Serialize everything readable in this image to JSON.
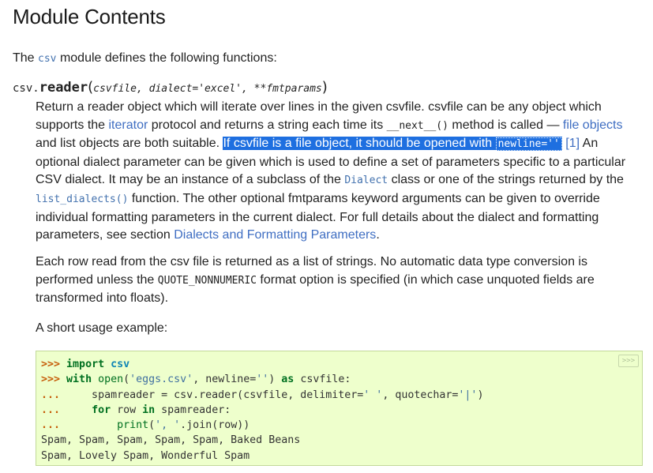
{
  "title": "Module Contents",
  "intro": {
    "pre": "The ",
    "code": "csv",
    "post": " module defines the following functions:"
  },
  "signature": {
    "prefix": "csv.",
    "name": "reader",
    "open": "(",
    "args": "csvfile, dialect='excel', **fmtparams",
    "close": ")"
  },
  "para1": {
    "l1": "Return a reader object which will iterate over lines in the given csvfile. csvfile can be any object which",
    "l2_a": "supports the ",
    "l2_link": "iterator",
    "l2_b": " protocol and returns a string each time its ",
    "l2_code": "__next__()",
    "l2_c": " method is called — ",
    "l2_link2": "file objects",
    "l3_a": "and list objects are both suitable. ",
    "l3_hl_a": "If csvfile is a file object, it should be opened with ",
    "l3_hl_code": "newline=''",
    "l3_footnote": "[1]",
    "l3_b": " An",
    "l4": "optional dialect parameter can be given which is used to define a set of parameters specific to a particular",
    "l5_a": "CSV dialect. It may be an instance of a subclass of the ",
    "l5_code": "Dialect",
    "l5_b": " class or one of the strings returned by the",
    "l6_code": "list_dialects()",
    "l6_b": " function. The other optional fmtparams keyword arguments can be given to override",
    "l7": "individual formatting parameters in the current dialect. For full details about the dialect and formatting",
    "l8_a": "parameters, see section ",
    "l8_link": "Dialects and Formatting Parameters",
    "l8_b": "."
  },
  "para2": {
    "l1": "Each row read from the csv file is returned as a list of strings. No automatic data type conversion is",
    "l2_a": "performed unless the ",
    "l2_code": "QUOTE_NONNUMERIC",
    "l2_b": " format option is specified (in which case unquoted fields are",
    "l3": "transformed into floats)."
  },
  "para3": "A short usage example:",
  "code": {
    "copy_label": ">>>",
    "lines": [
      {
        "prompt": ">>>",
        "text": " import csv"
      },
      {
        "prompt": ">>>",
        "text": " with open('eggs.csv', newline='') as csvfile:"
      },
      {
        "prompt": "...",
        "text": "     spamreader = csv.reader(csvfile, delimiter=' ', quotechar='|')"
      },
      {
        "prompt": "...",
        "text": "     for row in spamreader:"
      },
      {
        "prompt": "...",
        "text": "         print(', '.join(row))"
      },
      {
        "prompt": "",
        "text": "Spam, Spam, Spam, Spam, Spam, Baked Beans"
      },
      {
        "prompt": "",
        "text": "Spam, Lovely Spam, Wonderful Spam"
      }
    ]
  },
  "colors": {
    "link": "#3f6ec2",
    "highlight": "#1e6fe0",
    "code_bg": "#eeffcc",
    "code_border": "#c2d99a"
  }
}
